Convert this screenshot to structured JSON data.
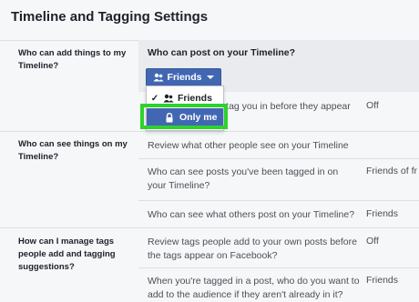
{
  "page": {
    "title": "Timeline and Tagging Settings"
  },
  "sections": [
    {
      "label": "Who can add things to my Timeline?",
      "questions": [
        {
          "text": "Who can post on your Timeline?",
          "value": ""
        },
        {
          "text": "s tag you in before they appear",
          "value": "Off"
        }
      ]
    },
    {
      "label": "Who can see things on my Timeline?",
      "questions": [
        {
          "text": "Review what other people see on your Timeline",
          "value": ""
        },
        {
          "text": "Who can see posts you've been tagged in on your Timeline?",
          "value": "Friends of fr"
        },
        {
          "text": "Who can see what others post on your Timeline?",
          "value": "Friends"
        }
      ]
    },
    {
      "label": "How can I manage tags people add and tagging suggestions?",
      "questions": [
        {
          "text": "Review tags people add to your own posts before the tags appear on Facebook?",
          "value": "Off"
        },
        {
          "text": "When you're tagged in a post, who do you want to add to the audience if they aren't already in it?",
          "value": "Friends"
        }
      ]
    }
  ],
  "audience_button": {
    "label": "Friends",
    "icon": "friends-icon"
  },
  "dropdown": {
    "items": [
      {
        "label": "Friends",
        "icon": "friends-icon",
        "checked": true
      },
      {
        "label": "Only me",
        "icon": "lock-icon",
        "highlighted": true
      }
    ]
  },
  "colors": {
    "accent": "#4267b2",
    "highlight_outline": "#2cd32c",
    "panel": "#e9ebee",
    "background": "#f6f7f9"
  }
}
